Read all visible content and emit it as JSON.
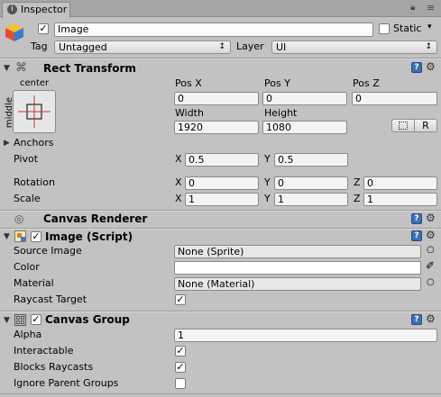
{
  "tab": {
    "title": "Inspector"
  },
  "header": {
    "name": "Image",
    "static_label": "Static",
    "tag_label": "Tag",
    "tag_value": "Untagged",
    "layer_label": "Layer",
    "layer_value": "UI"
  },
  "rect_transform": {
    "title": "Rect Transform",
    "anchor_h": "center",
    "anchor_v": "middle",
    "pos_x_label": "Pos X",
    "pos_y_label": "Pos Y",
    "pos_z_label": "Pos Z",
    "pos_x": "0",
    "pos_y": "0",
    "pos_z": "0",
    "width_label": "Width",
    "height_label": "Height",
    "width": "1920",
    "height": "1080",
    "r_button": "R",
    "anchors_label": "Anchors",
    "pivot_label": "Pivot",
    "pivot_x": "0.5",
    "pivot_y": "0.5",
    "rotation_label": "Rotation",
    "rot_x": "0",
    "rot_y": "0",
    "rot_z": "0",
    "scale_label": "Scale",
    "scale_x": "1",
    "scale_y": "1",
    "scale_z": "1",
    "x": "X",
    "y": "Y",
    "z": "Z"
  },
  "canvas_renderer": {
    "title": "Canvas Renderer"
  },
  "image_script": {
    "title": "Image (Script)",
    "source_image_label": "Source Image",
    "source_image_value": "None (Sprite)",
    "color_label": "Color",
    "color_value": "#ffffff",
    "material_label": "Material",
    "material_value": "None (Material)",
    "raycast_label": "Raycast Target",
    "raycast_checked": true
  },
  "canvas_group": {
    "title": "Canvas Group",
    "alpha_label": "Alpha",
    "alpha_value": "1",
    "interactable_label": "Interactable",
    "interactable_checked": true,
    "blocks_label": "Blocks Raycasts",
    "blocks_checked": true,
    "ignore_label": "Ignore Parent Groups",
    "ignore_checked": false
  }
}
